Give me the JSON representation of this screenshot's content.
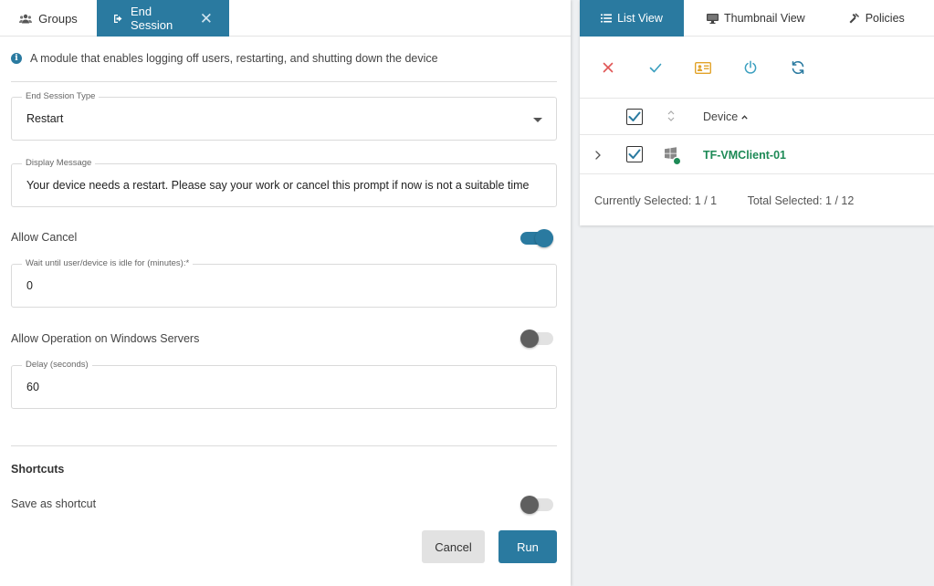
{
  "left_tabs": {
    "groups": "Groups",
    "end_session": "End Session"
  },
  "info_text": "A module that enables logging off users, restarting, and shutting down the device",
  "end_session_type": {
    "label": "End Session Type",
    "value": "Restart"
  },
  "display_message": {
    "label": "Display Message",
    "value": "Your device needs a restart. Please say your work or cancel this prompt if now is not a suitable time"
  },
  "allow_cancel": {
    "label": "Allow Cancel",
    "on": true
  },
  "idle_wait": {
    "label": "Wait until user/device is idle for (minutes):*",
    "value": "0"
  },
  "allow_servers": {
    "label": "Allow Operation on Windows Servers",
    "on": false
  },
  "delay": {
    "label": "Delay (seconds)",
    "value": "60"
  },
  "shortcuts": {
    "title": "Shortcuts",
    "save_label": "Save as shortcut",
    "on": false
  },
  "buttons": {
    "cancel": "Cancel",
    "run": "Run"
  },
  "right_tabs": {
    "list_view": "List View",
    "thumbnail_view": "Thumbnail View",
    "policies": "Policies"
  },
  "table": {
    "column_device": "Device",
    "rows": [
      {
        "device": "TF-VMClient-01",
        "checked": true,
        "status": "online"
      }
    ]
  },
  "footer": {
    "currently_selected": "Currently Selected: 1 / 1",
    "total_selected": "Total Selected: 1 / 12"
  },
  "colors": {
    "primary": "#2a7aa0",
    "danger": "#e05555",
    "success": "#3a9fbf",
    "warning": "#e2a32a",
    "device_link": "#1d8a56"
  },
  "icons": {
    "groups": "people-icon",
    "end_session": "logout-icon",
    "list_view": "list-icon",
    "thumbnail_view": "monitor-icon",
    "policies": "hammer-icon",
    "toolbar": [
      "x-icon",
      "check-icon",
      "id-card-icon",
      "power-icon",
      "refresh-icon"
    ]
  }
}
